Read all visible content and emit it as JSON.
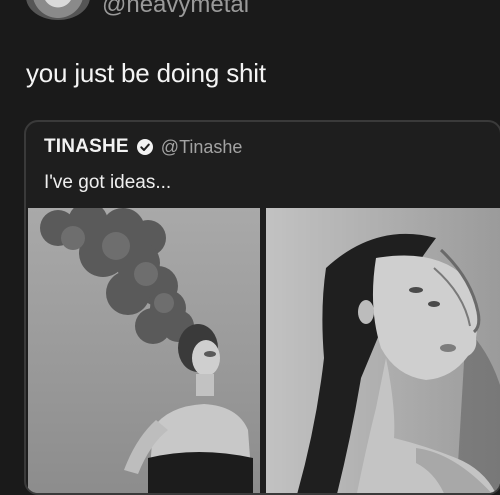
{
  "tweet": {
    "handle": "@heavymetal",
    "text": "you just be doing shit"
  },
  "quoted_tweet": {
    "name": "TINASHE",
    "handle": "@Tinashe",
    "text": "I've got ideas..."
  },
  "icons": {
    "verified": "verified-badge-icon"
  }
}
